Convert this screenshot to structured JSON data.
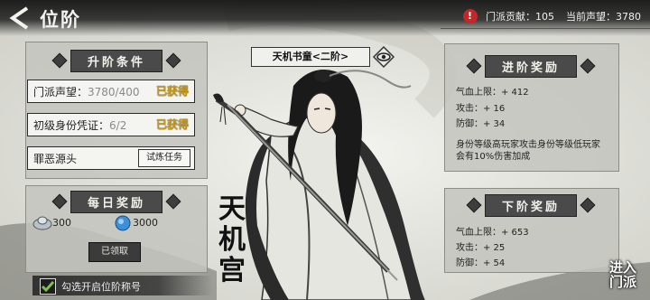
{
  "header": {
    "title": "位阶",
    "contribution": "门派贡献：105",
    "current_fame": "当前声望：3780"
  },
  "requirements": {
    "title": "升阶条件",
    "rows": [
      {
        "label": "门派声望：",
        "value": "3780/400",
        "status": "已获得"
      },
      {
        "label": "初级身份凭证：",
        "value": "6/2",
        "status": "已获得"
      },
      {
        "label": "罪恶源头",
        "value": "",
        "button": "试炼任务"
      }
    ]
  },
  "daily": {
    "title": "每日奖励",
    "silver": "300",
    "gems": "3000",
    "claimed_label": "已领取"
  },
  "character": {
    "rank_label": "天机书童<二阶>",
    "sect_name": "天机宫"
  },
  "advance": {
    "title": "进阶奖励",
    "lines": [
      "气血上限：+ 412",
      "攻击：+ 16",
      "防御：+ 34"
    ],
    "note_line1": "身份等级高玩家攻击身份等级低玩家",
    "note_line2": "会有10%伤害加成"
  },
  "next": {
    "title": "下阶奖励",
    "lines": [
      "气血上限：+ 653",
      "攻击：+ 25",
      "防御：+ 54"
    ]
  },
  "footer": {
    "checkbox_label": "勾选开启位阶称号",
    "enter_line1": "进入",
    "enter_line2": "门派"
  },
  "colors": {
    "gold": "#c69a1a",
    "alert_red": "#c0282a",
    "dark_bar": "#4a4a4a"
  }
}
